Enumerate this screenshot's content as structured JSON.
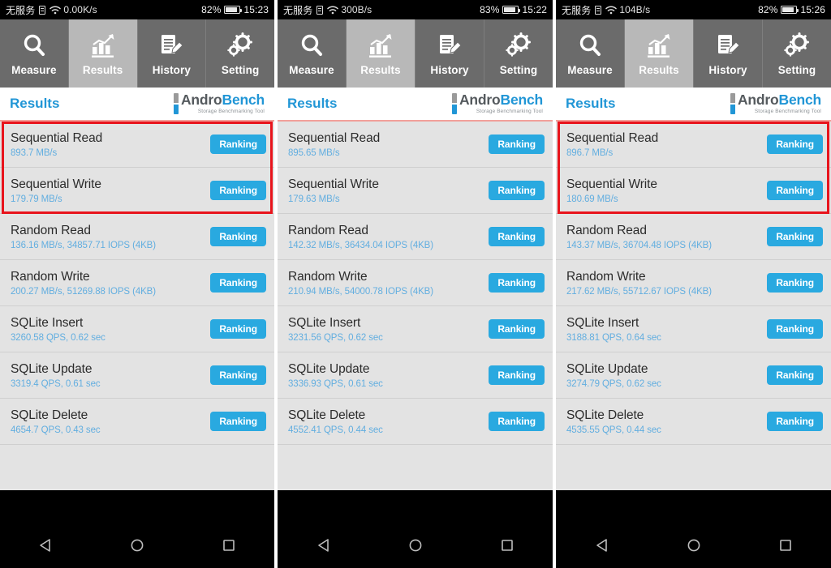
{
  "panels": [
    {
      "status": {
        "carrier": "无服务",
        "sim_icon": "sim-card-icon",
        "wifi_icon": "wifi-icon",
        "speed": "0.00K/s",
        "battery_pct": "82%",
        "battery_icon": "battery-icon",
        "time": "15:23"
      },
      "tabs": [
        {
          "label": "Measure",
          "icon": "magnifier-icon",
          "active": false
        },
        {
          "label": "Results",
          "icon": "bar-chart-icon",
          "active": true
        },
        {
          "label": "History",
          "icon": "document-pen-icon",
          "active": false
        },
        {
          "label": "Setting",
          "icon": "gears-icon",
          "active": false
        }
      ],
      "header": {
        "title": "Results",
        "logo_primary": "Andro",
        "logo_secondary": "Bench",
        "logo_tagline": "Storage Benchmarking Tool"
      },
      "highlight": true,
      "rows": [
        {
          "title": "Sequential Read",
          "value": "893.7 MB/s",
          "button": "Ranking"
        },
        {
          "title": "Sequential Write",
          "value": "179.79 MB/s",
          "button": "Ranking"
        },
        {
          "title": "Random Read",
          "value": "136.16 MB/s, 34857.71 IOPS (4KB)",
          "button": "Ranking"
        },
        {
          "title": "Random Write",
          "value": "200.27 MB/s, 51269.88 IOPS (4KB)",
          "button": "Ranking"
        },
        {
          "title": "SQLite Insert",
          "value": "3260.58 QPS, 0.62 sec",
          "button": "Ranking"
        },
        {
          "title": "SQLite Update",
          "value": "3319.4 QPS, 0.61 sec",
          "button": "Ranking"
        },
        {
          "title": "SQLite Delete",
          "value": "4654.7 QPS, 0.43 sec",
          "button": "Ranking"
        }
      ],
      "navbar": [
        {
          "icon": "back-triangle-icon"
        },
        {
          "icon": "home-circle-icon"
        },
        {
          "icon": "recents-square-icon"
        }
      ]
    },
    {
      "status": {
        "carrier": "无服务",
        "sim_icon": "sim-card-icon",
        "wifi_icon": "wifi-icon",
        "speed": "300B/s",
        "battery_pct": "83%",
        "battery_icon": "battery-icon",
        "time": "15:22"
      },
      "tabs": [
        {
          "label": "Measure",
          "icon": "magnifier-icon",
          "active": false
        },
        {
          "label": "Results",
          "icon": "bar-chart-icon",
          "active": true
        },
        {
          "label": "History",
          "icon": "document-pen-icon",
          "active": false
        },
        {
          "label": "Setting",
          "icon": "gears-icon",
          "active": false
        }
      ],
      "header": {
        "title": "Results",
        "logo_primary": "Andro",
        "logo_secondary": "Bench",
        "logo_tagline": "Storage Benchmarking Tool"
      },
      "highlight": false,
      "rows": [
        {
          "title": "Sequential Read",
          "value": "895.65 MB/s",
          "button": "Ranking"
        },
        {
          "title": "Sequential Write",
          "value": "179.63 MB/s",
          "button": "Ranking"
        },
        {
          "title": "Random Read",
          "value": "142.32 MB/s, 36434.04 IOPS (4KB)",
          "button": "Ranking"
        },
        {
          "title": "Random Write",
          "value": "210.94 MB/s, 54000.78 IOPS (4KB)",
          "button": "Ranking"
        },
        {
          "title": "SQLite Insert",
          "value": "3231.56 QPS, 0.62 sec",
          "button": "Ranking"
        },
        {
          "title": "SQLite Update",
          "value": "3336.93 QPS, 0.61 sec",
          "button": "Ranking"
        },
        {
          "title": "SQLite Delete",
          "value": "4552.41 QPS, 0.44 sec",
          "button": "Ranking"
        }
      ],
      "navbar": [
        {
          "icon": "back-triangle-icon"
        },
        {
          "icon": "home-circle-icon"
        },
        {
          "icon": "recents-square-icon"
        }
      ]
    },
    {
      "status": {
        "carrier": "无服务",
        "sim_icon": "sim-card-icon",
        "wifi_icon": "wifi-icon",
        "speed": "104B/s",
        "battery_pct": "82%",
        "battery_icon": "battery-icon",
        "time": "15:26"
      },
      "tabs": [
        {
          "label": "Measure",
          "icon": "magnifier-icon",
          "active": false
        },
        {
          "label": "Results",
          "icon": "bar-chart-icon",
          "active": true
        },
        {
          "label": "History",
          "icon": "document-pen-icon",
          "active": false
        },
        {
          "label": "Setting",
          "icon": "gears-icon",
          "active": false
        }
      ],
      "header": {
        "title": "Results",
        "logo_primary": "Andro",
        "logo_secondary": "Bench",
        "logo_tagline": "Storage Benchmarking Tool"
      },
      "highlight": true,
      "rows": [
        {
          "title": "Sequential Read",
          "value": "896.7 MB/s",
          "button": "Ranking"
        },
        {
          "title": "Sequential Write",
          "value": "180.69 MB/s",
          "button": "Ranking"
        },
        {
          "title": "Random Read",
          "value": "143.37 MB/s, 36704.48 IOPS (4KB)",
          "button": "Ranking"
        },
        {
          "title": "Random Write",
          "value": "217.62 MB/s, 55712.67 IOPS (4KB)",
          "button": "Ranking"
        },
        {
          "title": "SQLite Insert",
          "value": "3188.81 QPS, 0.64 sec",
          "button": "Ranking"
        },
        {
          "title": "SQLite Update",
          "value": "3274.79 QPS, 0.62 sec",
          "button": "Ranking"
        },
        {
          "title": "SQLite Delete",
          "value": "4535.55 QPS, 0.44 sec",
          "button": "Ranking"
        }
      ],
      "navbar": [
        {
          "icon": "back-triangle-icon"
        },
        {
          "icon": "home-circle-icon"
        },
        {
          "icon": "recents-square-icon"
        }
      ]
    }
  ],
  "colors": {
    "accent_blue": "#29a9e0",
    "title_blue": "#2196d6",
    "value_blue": "#62aee0",
    "highlight_red": "#e8141c",
    "tabbar_gray": "#6b6b6b",
    "tab_active_gray": "#b8b8b8",
    "list_bg": "#e3e3e3"
  }
}
